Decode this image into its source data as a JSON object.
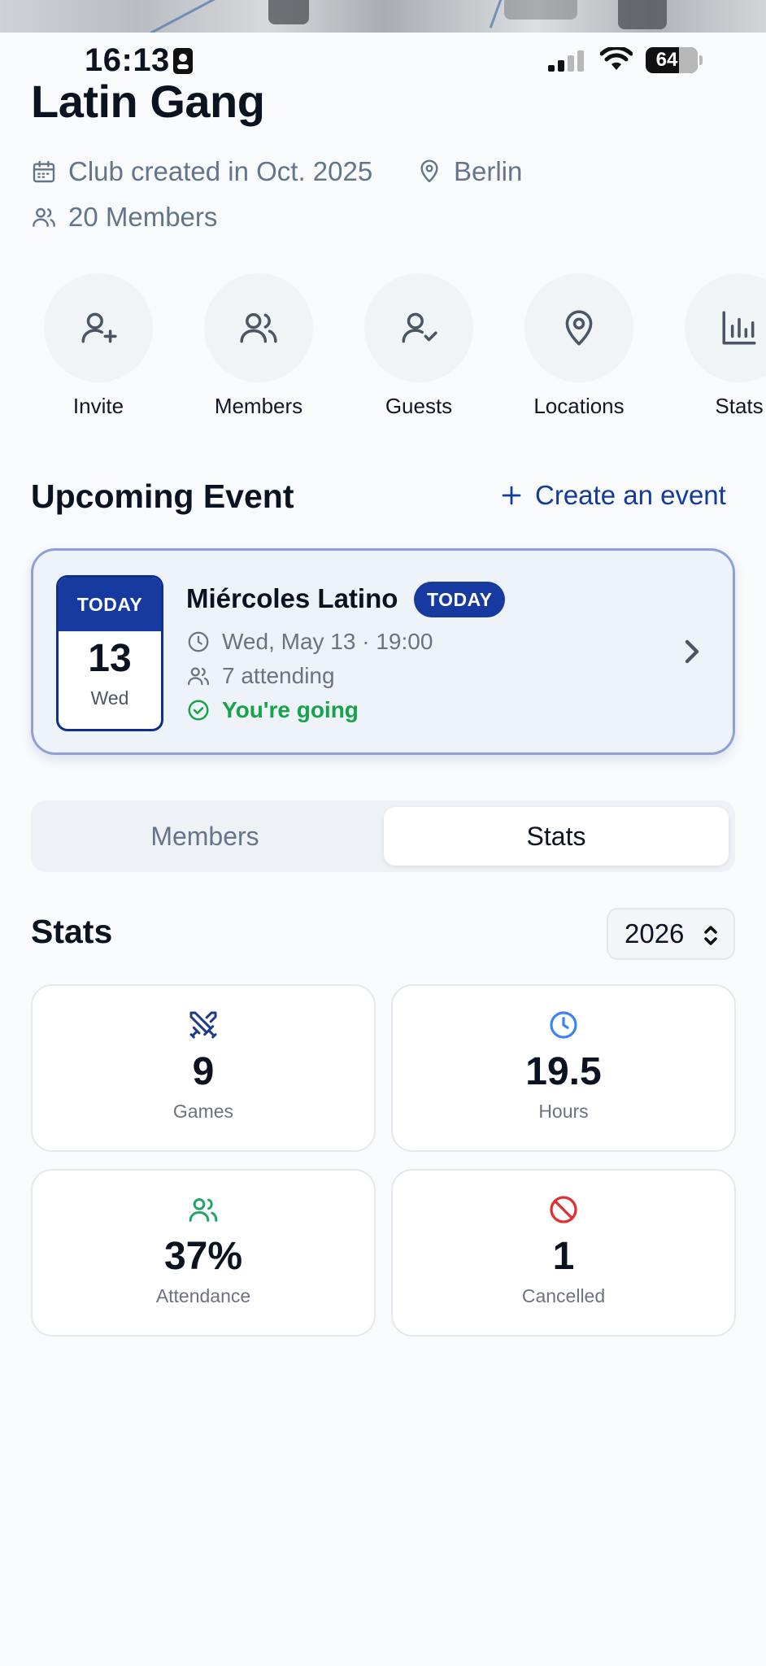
{
  "status_bar": {
    "time": "16:13",
    "battery": "64"
  },
  "club": {
    "name": "Latin Gang",
    "created": "Club created in Oct. 2025",
    "location": "Berlin",
    "members": "20 Members"
  },
  "actions": [
    {
      "label": "Invite",
      "icon": "user-plus-icon"
    },
    {
      "label": "Members",
      "icon": "users-icon"
    },
    {
      "label": "Guests",
      "icon": "user-check-icon"
    },
    {
      "label": "Locations",
      "icon": "map-pin-icon"
    },
    {
      "label": "Stats",
      "icon": "bar-chart-icon"
    }
  ],
  "upcoming": {
    "heading": "Upcoming Event",
    "create_label": "Create an event"
  },
  "event": {
    "badge_top": "TODAY",
    "day": "13",
    "weekday": "Wed",
    "title": "Miércoles Latino",
    "pill": "TODAY",
    "datetime": "Wed, May 13 · 19:00",
    "attending": "7 attending",
    "status": "You're going"
  },
  "tabs": {
    "members": "Members",
    "stats": "Stats",
    "selected": "Stats"
  },
  "stats": {
    "heading": "Stats",
    "year": "2026",
    "cards": [
      {
        "value": "9",
        "label": "Games",
        "icon": "crossed-swords-icon",
        "color": "#1e3a8a"
      },
      {
        "value": "19.5",
        "label": "Hours",
        "icon": "clock-icon",
        "color": "#3b82f6"
      },
      {
        "value": "37%",
        "label": "Attendance",
        "icon": "users-icon",
        "color": "#22a565"
      },
      {
        "value": "1",
        "label": "Cancelled",
        "icon": "ban-icon",
        "color": "#e03131"
      }
    ]
  },
  "colors": {
    "accent": "#163aa0",
    "success": "#16a34a",
    "muted": "#64748b"
  }
}
